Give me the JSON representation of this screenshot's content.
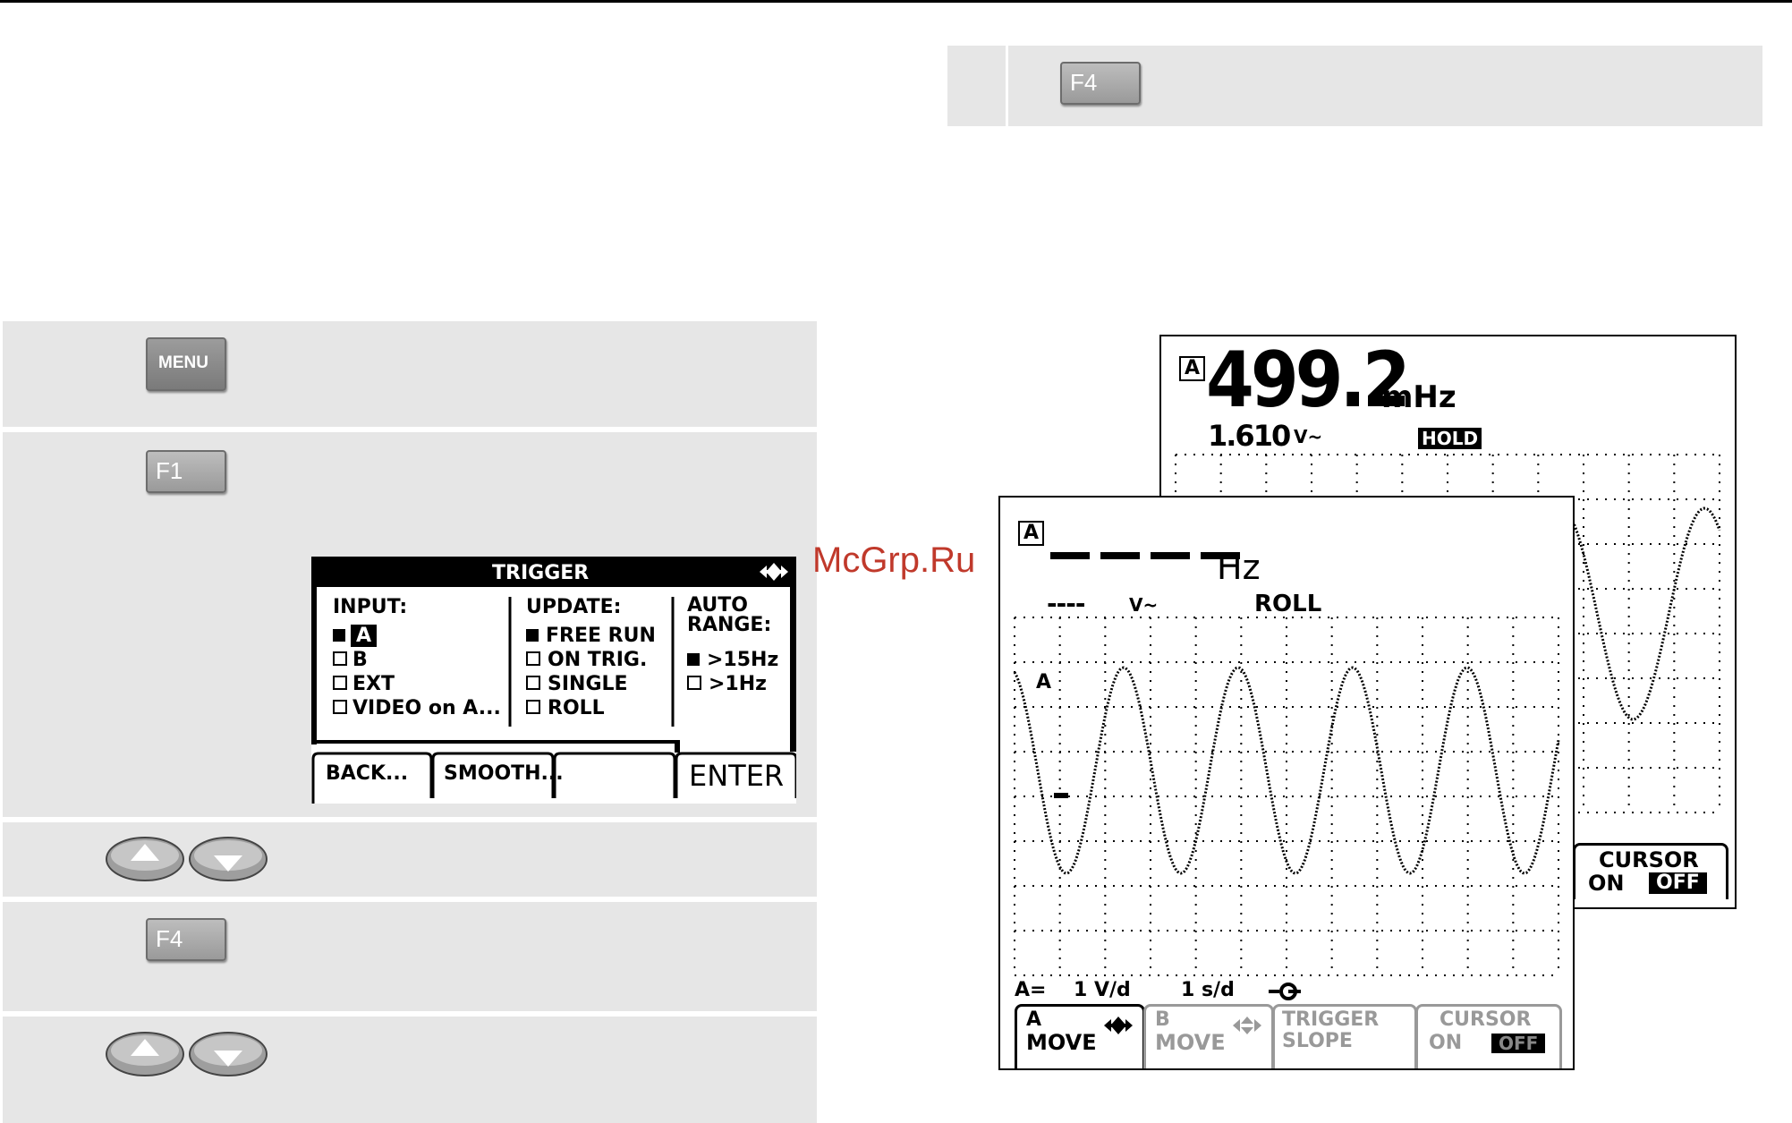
{
  "keys": {
    "f4_top": "F4",
    "menu": "MENU",
    "f1": "F1",
    "f4_lower": "F4"
  },
  "trigger_menu": {
    "title": "TRIGGER",
    "input_header": "INPUT:",
    "input_options": [
      "A",
      "B",
      "EXT",
      "VIDEO on A..."
    ],
    "input_selected": "A",
    "update_header": "UPDATE:",
    "update_options": [
      "FREE RUN",
      "ON TRIG.",
      "SINGLE",
      "ROLL"
    ],
    "update_selected": "FREE RUN",
    "autorange_header_1": "AUTO",
    "autorange_header_2": "RANGE:",
    "autorange_options": [
      ">15Hz",
      ">1Hz"
    ],
    "autorange_selected": ">15Hz",
    "softkeys": [
      "BACK...",
      "SMOOTH...",
      "",
      "ENTER"
    ]
  },
  "watermark": "McGrp.Ru",
  "back_screen": {
    "channel": "A",
    "reading": "499.2",
    "unit": "mHz",
    "sub_reading": "1.610",
    "sub_unit": "V~",
    "status": "HOLD",
    "cursor_label": "CURSOR",
    "cursor_on": "ON",
    "cursor_off": "OFF"
  },
  "front_screen": {
    "channel": "A",
    "reading": "- - - -",
    "unit": "Hz",
    "sub_reading": "----",
    "sub_unit": "V~",
    "mode": "ROLL",
    "trace_label": "A",
    "status_channel": "A=",
    "volts_div": "1 V/d",
    "time_div": "1 s/d",
    "softkeys": [
      {
        "line1": "A",
        "line2": "MOVE"
      },
      {
        "line1": "B",
        "line2": "MOVE"
      },
      {
        "line1": "TRIGGER",
        "line2": "SLOPE"
      },
      {
        "line1": "CURSOR",
        "line2": "ON",
        "line3": "OFF"
      }
    ]
  }
}
